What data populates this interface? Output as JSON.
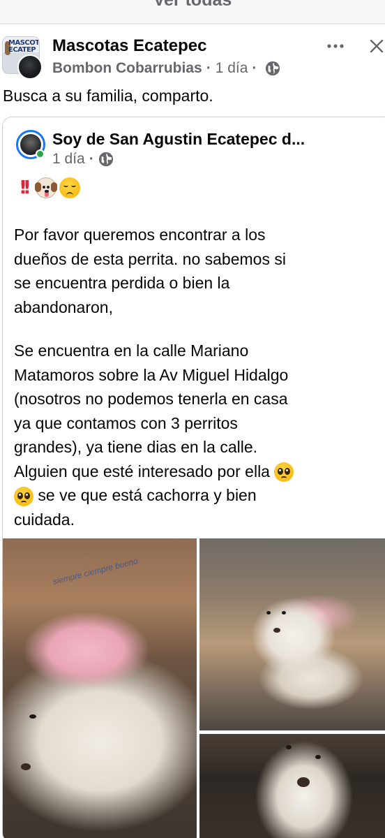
{
  "top_bar": {
    "see_all_label": "Ver todas"
  },
  "post": {
    "group_name": "Mascotas Ecatepec",
    "group_avatar_text": "MASCOTAS ECATEP",
    "author_name": "Bombon Cobarrubias",
    "time_ago": "1 día",
    "privacy_icon": "globe-icon",
    "more_icon": "more-horizontal-icon",
    "close_icon": "close-icon",
    "caption": "Busca a su familia, comparto."
  },
  "shared_post": {
    "page_name": "Soy de San Agustin Ecatepec d...",
    "time_ago": "1 día",
    "privacy_icon": "globe-icon",
    "status": "online",
    "header_emojis": [
      "double-exclamation-icon",
      "dog-face-icon",
      "disappointed-face-icon"
    ],
    "paragraph1_lines": [
      "Por favor queremos encontrar a los",
      "dueños de esta perrita. no sabemos si",
      "se encuentra perdida o bien la",
      "abandonaron,"
    ],
    "paragraph2_lines": [
      "Se encuentra en la calle Mariano",
      "Matamoros sobre la Av Miguel Hidalgo",
      "(nosotros no podemos tenerla en casa",
      "ya que contamos con 3 perritos",
      "grandes), ya tiene dias en la calle.",
      "Alguien que esté interesado por ella",
      "se ve que está cachorra y bien",
      "cuidada."
    ],
    "trailing_emojis": [
      "pleading-face-icon",
      "pleading-face-icon"
    ],
    "photos": [
      "dog-photo-1",
      "dog-photo-2",
      "dog-photo-3"
    ]
  },
  "colors": {
    "accent_blue": "#1877f2",
    "online_green": "#31a24c",
    "secondary_text": "#65676b",
    "alert_red": "#e0243a"
  }
}
